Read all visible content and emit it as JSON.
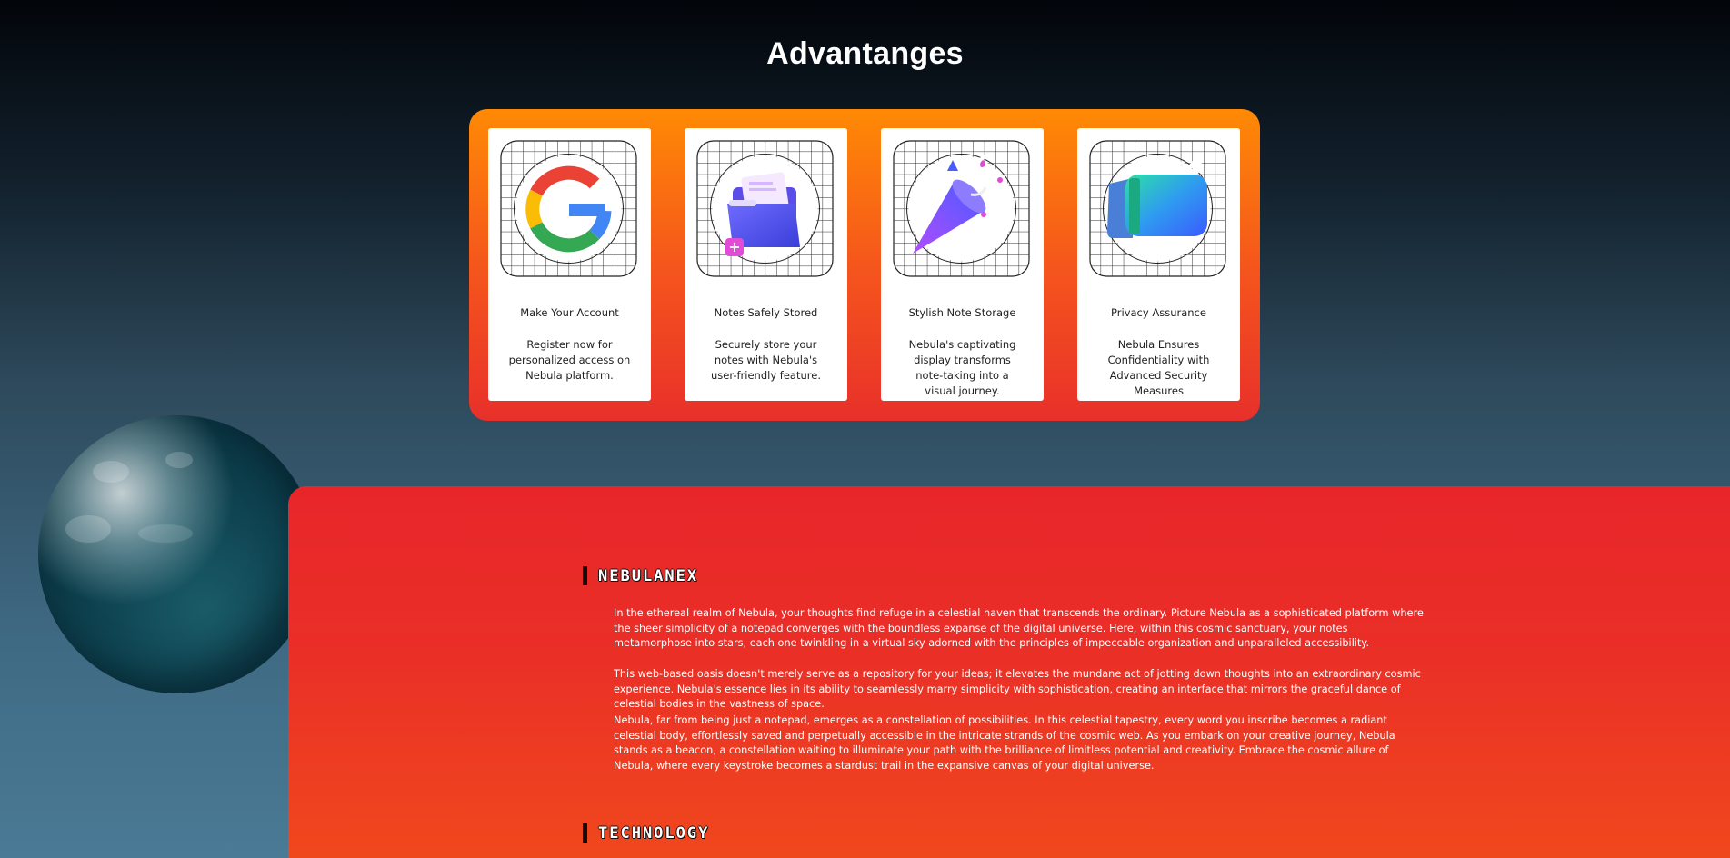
{
  "page": {
    "title": "Advantanges"
  },
  "advantages": {
    "cards": [
      {
        "icon": "google-logo-icon",
        "heading": "Make Your Account",
        "description": "Register now for personalized access on Nebula platform."
      },
      {
        "icon": "folder-notes-icon",
        "heading": "Notes Safely Stored",
        "description": "Securely store your notes with Nebula's user-friendly feature."
      },
      {
        "icon": "party-popper-icon",
        "heading": "Stylish Note Storage",
        "description": "Nebula's captivating display transforms note-taking into a visual journey."
      },
      {
        "icon": "wallet-shield-icon",
        "heading": "Privacy Assurance",
        "description": "Nebula Ensures Confidentiality with Advanced Security Measures"
      }
    ]
  },
  "about": {
    "heading": "NEBULANEX",
    "paragraphs": [
      "In the ethereal realm of Nebula, your thoughts find refuge in a celestial haven that transcends the ordinary. Picture Nebula as a sophisticated platform where the sheer simplicity of a notepad converges with the boundless expanse of the digital universe. Here, within this cosmic sanctuary, your notes metamorphose into stars, each one twinkling in a virtual sky adorned with the principles of impeccable organization and unparalleled accessibility.",
      "This web-based oasis doesn't merely serve as a repository for your ideas; it elevates the mundane act of jotting down thoughts into an extraordinary cosmic experience. Nebula's essence lies in its ability to seamlessly marry simplicity with sophistication, creating an interface that mirrors the graceful dance of celestial bodies in the vastness of space.",
      "Nebula, far from being just a notepad, emerges as a constellation of possibilities. In this celestial tapestry, every word you inscribe becomes a radiant celestial body, effortlessly saved and perpetually accessible in the intricate strands of the cosmic web. As you embark on your creative journey, Nebula stands as a beacon, a constellation waiting to illuminate your path with the brilliance of limitless potential and creativity. Embrace the cosmic allure of Nebula, where every keystroke becomes a stardust trail in the expansive canvas of your digital universe."
    ]
  },
  "technology": {
    "heading": "TECHNOLOGY"
  },
  "colors": {
    "accent_orange": "#ff8a05",
    "accent_red": "#e8262a"
  }
}
